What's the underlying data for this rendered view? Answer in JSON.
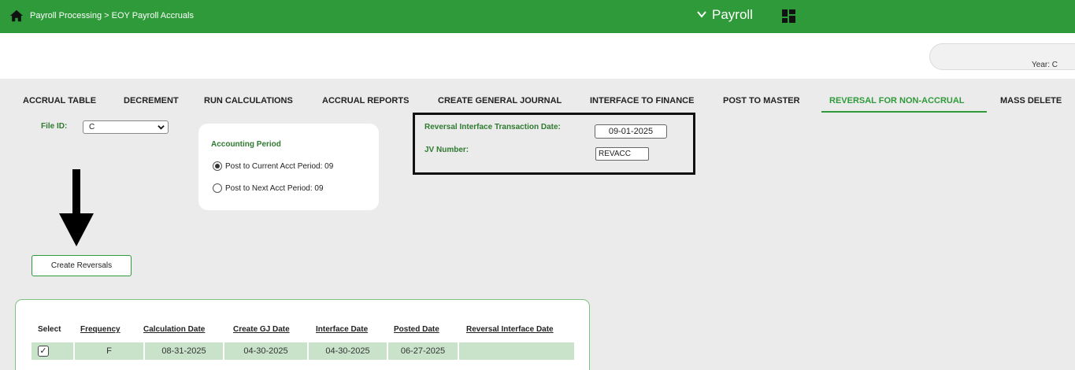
{
  "topbar": {
    "breadcrumb": "Payroll Processing > EOY Payroll Accruals",
    "app_title": "Payroll",
    "icons": [
      "home-icon",
      "chevron-down-icon",
      "grid-menu-icon"
    ]
  },
  "header": {
    "year_label": "Year: C"
  },
  "tabs": [
    {
      "label": "ACCRUAL TABLE"
    },
    {
      "label": "DECREMENT"
    },
    {
      "label": "RUN CALCULATIONS"
    },
    {
      "label": "ACCRUAL REPORTS"
    },
    {
      "label": "CREATE GENERAL JOURNAL"
    },
    {
      "label": "INTERFACE TO FINANCE"
    },
    {
      "label": "POST TO MASTER"
    },
    {
      "label": "REVERSAL FOR NON-ACCRUAL",
      "active": true
    },
    {
      "label": "MASS DELETE"
    }
  ],
  "file_id": {
    "label": "File ID:",
    "value": "C"
  },
  "accounting_period": {
    "title": "Accounting Period",
    "options": [
      {
        "label": "Post to Current Acct Period: 09",
        "checked": true
      },
      {
        "label": "Post to Next Acct Period: 09",
        "checked": false
      }
    ]
  },
  "reversal": {
    "date_label": "Reversal Interface Transaction Date:",
    "date_value": "09-01-2025",
    "jv_label": "JV Number:",
    "jv_value": "REVACC"
  },
  "create_button": "Create Reversals",
  "table": {
    "headers": [
      "Select",
      "Frequency",
      "Calculation Date",
      "Create GJ Date",
      "Interface Date",
      "Posted Date",
      "Reversal Interface Date"
    ],
    "rows": [
      {
        "select": "✓",
        "frequency": "F",
        "calculation_date": "08-31-2025",
        "create_gj_date": "04-30-2025",
        "interface_date": "04-30-2025",
        "posted_date": "06-27-2025",
        "reversal_interface_date": ""
      }
    ]
  },
  "colors": {
    "brand_green": "#2f9a3a",
    "label_green": "#2f7a30",
    "row_highlight": "#c9e3ca"
  }
}
